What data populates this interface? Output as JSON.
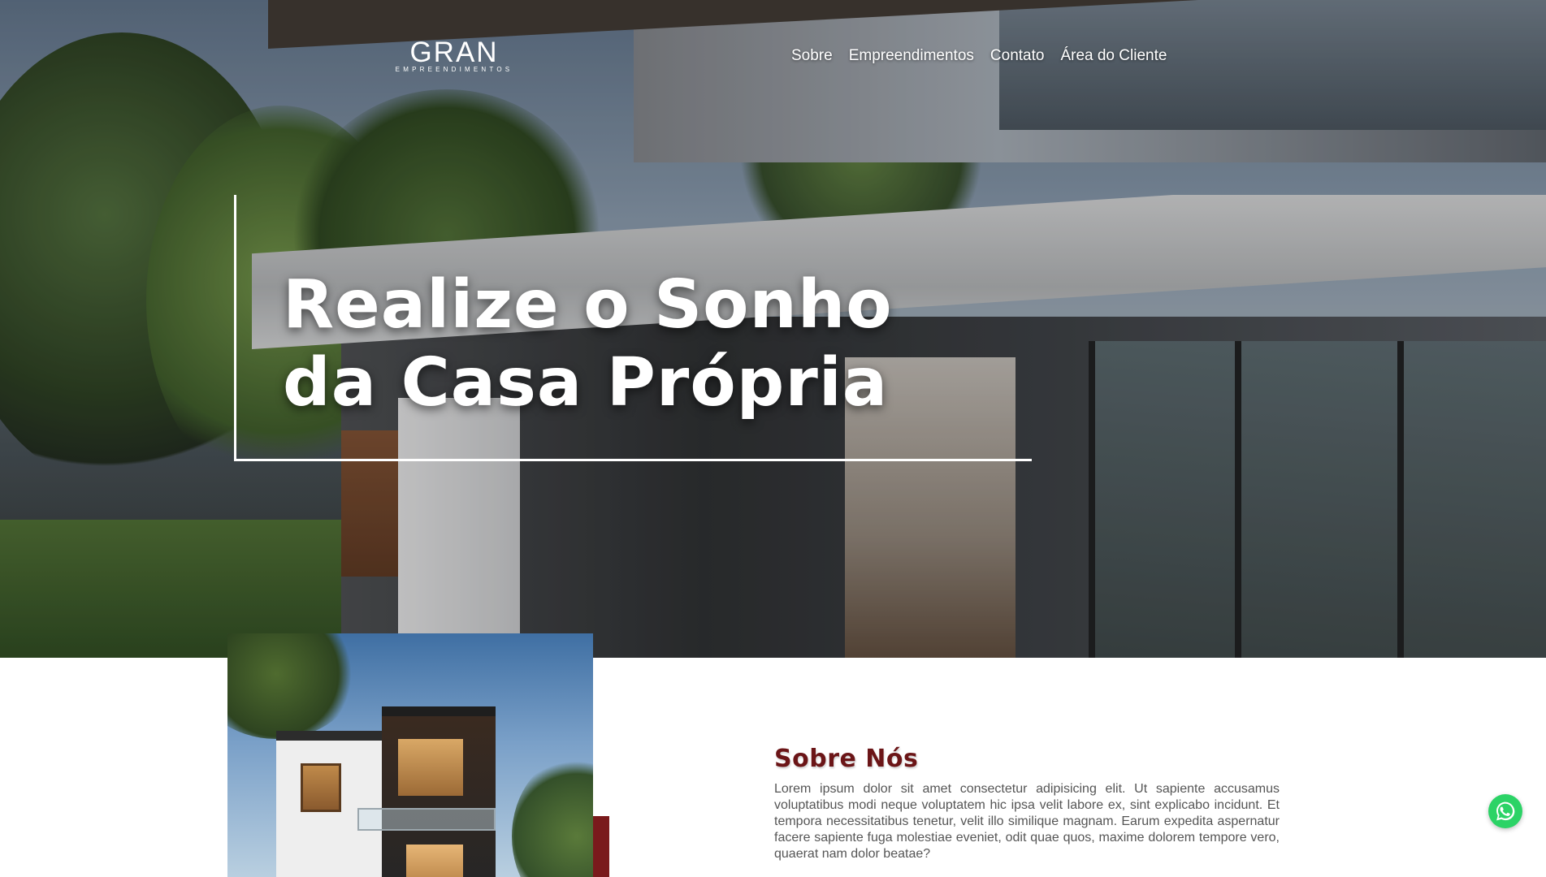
{
  "brand": {
    "name": "GRAN",
    "tagline": "EMPREENDIMENTOS"
  },
  "nav": {
    "items": [
      "Sobre",
      "Empreendimentos",
      "Contato",
      "Área do Cliente"
    ]
  },
  "hero": {
    "headline_line1": "Realize o Sonho",
    "headline_line2": "da Casa Própria"
  },
  "about": {
    "title": "Sobre Nós",
    "text": "Lorem ipsum dolor sit amet consectetur adipisicing elit. Ut sapiente accusamus voluptatibus modi neque voluptatem hic ipsa velit labore ex, sint explicabo incidunt. Et tempora necessitatibus tenetur, velit illo similique magnam. Earum expedita aspernatur facere sapiente fuga molestiae eveniet, odit quae quos, maxime dolorem tempore vero, quaerat nam dolor beatae?"
  },
  "colors": {
    "accent": "#6b1517",
    "whatsapp": "#2bd366"
  },
  "icons": {
    "whatsapp": "whatsapp-icon"
  }
}
